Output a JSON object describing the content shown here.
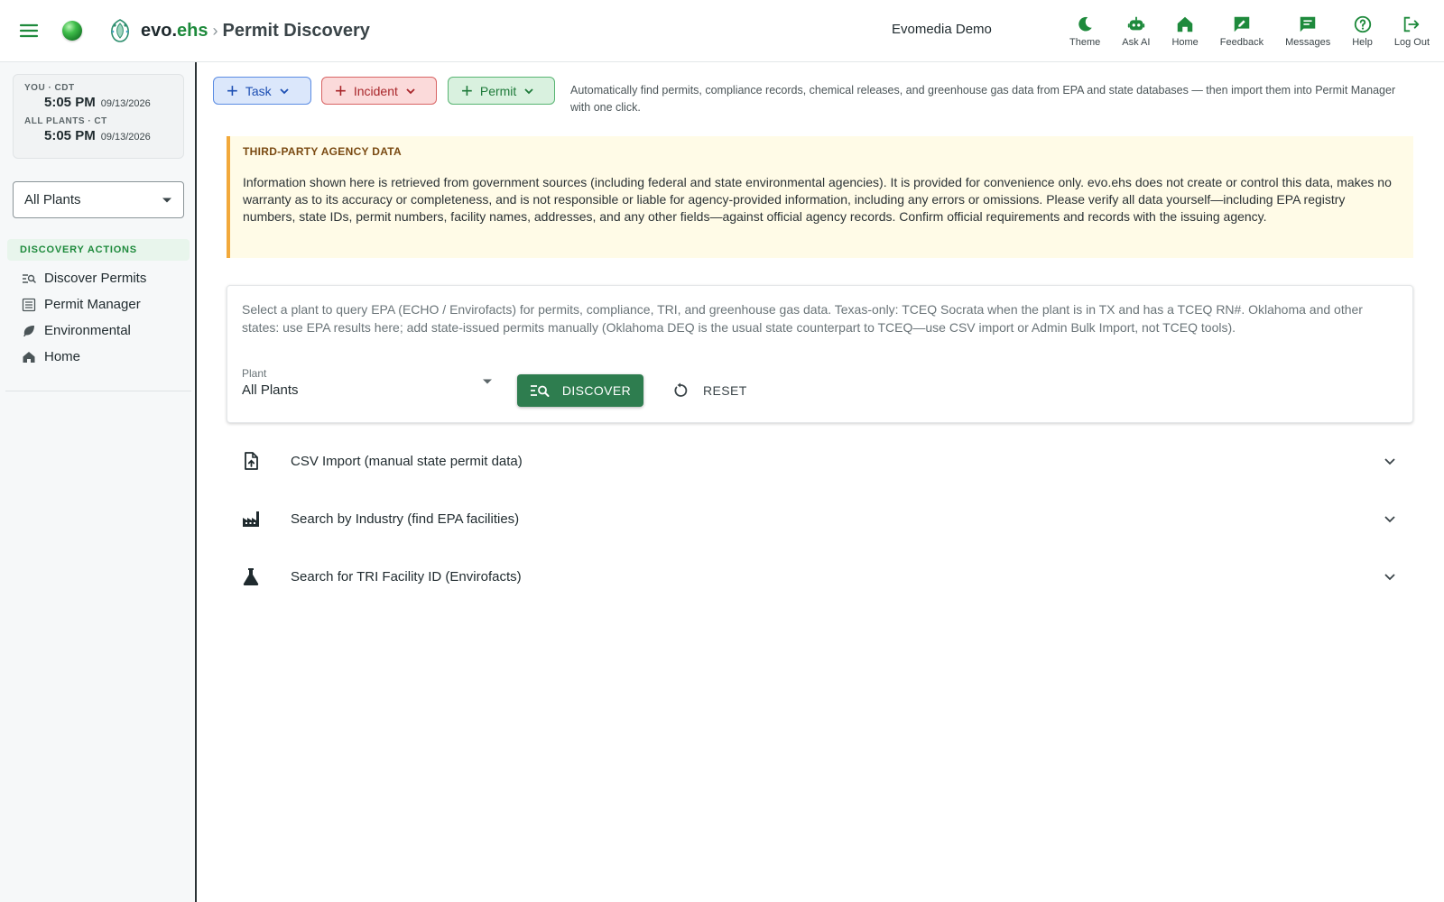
{
  "header": {
    "brand_evo": "evo.",
    "brand_ehs": "ehs",
    "breadcrumb_sep": "›",
    "page_title": "Permit Discovery",
    "org_name": "Evomedia Demo",
    "nav": [
      {
        "label": "Theme",
        "icon": "moon-icon"
      },
      {
        "label": "Ask AI",
        "icon": "robot-icon"
      },
      {
        "label": "Home",
        "icon": "home-icon"
      },
      {
        "label": "Feedback",
        "icon": "feedback-icon"
      },
      {
        "label": "Messages",
        "icon": "message-icon"
      },
      {
        "label": "Help",
        "icon": "help-icon"
      },
      {
        "label": "Log Out",
        "icon": "logout-icon"
      }
    ],
    "accent_color": "#1e8a3c"
  },
  "sidebar": {
    "clock_you_label": "YOU · CDT",
    "clock_you_time": "5:05 PM",
    "clock_you_date": "09/13/2026",
    "clock_plants_label": "ALL PLANTS · CT",
    "clock_plants_time": "5:05 PM",
    "clock_plants_date": "09/13/2026",
    "plant_select": "All Plants",
    "section_label": "DISCOVERY ACTIONS",
    "items": [
      {
        "label": "Discover Permits",
        "icon": "search-list-icon"
      },
      {
        "label": "Permit Manager",
        "icon": "list-icon"
      },
      {
        "label": "Environmental",
        "icon": "leaf-icon"
      },
      {
        "label": "Home",
        "icon": "home-icon"
      }
    ]
  },
  "quick_actions": {
    "task": "Task",
    "incident": "Incident",
    "permit": "Permit",
    "intro": "Automatically find permits, compliance records, chemical releases, and greenhouse gas data from EPA and state databases — then import them into Permit Manager with one click."
  },
  "notice": {
    "title": "THIRD-PARTY AGENCY DATA",
    "body": "Information shown here is retrieved from government sources (including federal and state environmental agencies). It is provided for convenience only. evo.ehs does not create or control this data, makes no warranty as to its accuracy or completeness, and is not responsible or liable for agency-provided information, including any errors or omissions. Please verify all data yourself—including EPA registry numbers, state IDs, permit numbers, facility names, addresses, and any other fields—against official agency records. Confirm official requirements and records with the issuing agency."
  },
  "query_card": {
    "description": "Select a plant to query EPA (ECHO / Envirofacts) for permits, compliance, TRI, and greenhouse gas data. Texas-only: TCEQ Socrata when the plant is in TX and has a TCEQ RN#. Oklahoma and other states: use EPA results here; add state-issued permits manually (Oklahoma DEQ is the usual state counterpart to TCEQ—use CSV import or Admin Bulk Import, not TCEQ tools).",
    "plant_label": "Plant",
    "plant_value": "All Plants",
    "discover_label": "DISCOVER",
    "reset_label": "RESET"
  },
  "accordions": [
    {
      "title": "CSV Import (manual state permit data)",
      "icon": "file-upload-icon"
    },
    {
      "title": "Search by Industry (find EPA facilities)",
      "icon": "factory-icon"
    },
    {
      "title": "Search for TRI Facility ID (Envirofacts)",
      "icon": "flask-icon"
    }
  ]
}
